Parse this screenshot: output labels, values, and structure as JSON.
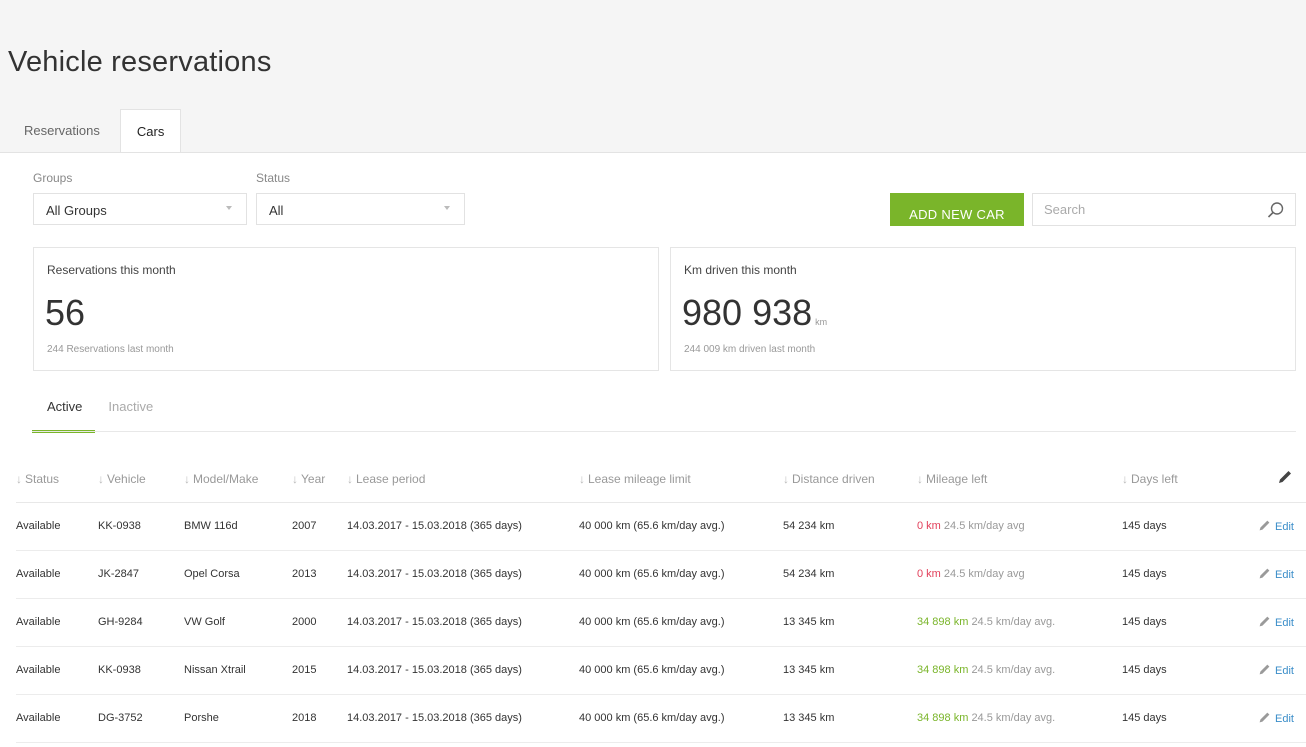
{
  "page": {
    "title": "Vehicle reservations"
  },
  "tabs": [
    {
      "label": "Reservations",
      "active": false
    },
    {
      "label": "Cars",
      "active": true
    }
  ],
  "filters": {
    "groups_label": "Groups",
    "groups_value": "All Groups",
    "status_label": "Status",
    "status_value": "All"
  },
  "actions": {
    "add_label": "ADD NEW CAR",
    "search_placeholder": "Search"
  },
  "stats": {
    "reservations": {
      "label": "Reservations this month",
      "value": "56",
      "sub": "244 Reservations last month"
    },
    "km": {
      "label": "Km driven this month",
      "value": "980 938",
      "unit": "km",
      "sub": "244 009 km driven last month"
    }
  },
  "status_tabs": [
    {
      "label": "Active",
      "active": true
    },
    {
      "label": "Inactive",
      "active": false
    }
  ],
  "table": {
    "columns": [
      "Status",
      "Vehicle",
      "Model/Make",
      "Year",
      "Lease period",
      "Lease mileage limit",
      "Distance driven",
      "Mileage left",
      "Days left"
    ],
    "edit_label": "Edit",
    "rows": [
      {
        "status": "Available",
        "vehicle": "KK-0938",
        "model": "BMW 116d",
        "year": "2007",
        "lease": "14.03.2017 - 15.03.2018 (365 days)",
        "limit": "40 000 km (65.6 km/day avg.)",
        "driven": "54 234 km",
        "driven_state": "over",
        "left": "0 km",
        "left_avg": "24.5 km/day avg",
        "days": "145 days"
      },
      {
        "status": "Available",
        "vehicle": "JK-2847",
        "model": "Opel Corsa",
        "year": "2013",
        "lease": "14.03.2017 - 15.03.2018 (365 days)",
        "limit": "40 000 km (65.6 km/day avg.)",
        "driven": "54 234 km",
        "driven_state": "over",
        "left": "0 km",
        "left_avg": "24.5 km/day avg",
        "days": "145 days"
      },
      {
        "status": "Available",
        "vehicle": "GH-9284",
        "model": "VW Golf",
        "year": "2000",
        "lease": "14.03.2017 - 15.03.2018 (365 days)",
        "limit": "40 000 km (65.6 km/day avg.)",
        "driven": "13 345 km",
        "driven_state": "ok",
        "left": "34 898 km",
        "left_avg": "24.5 km/day avg.",
        "days": "145 days"
      },
      {
        "status": "Available",
        "vehicle": "KK-0938",
        "model": "Nissan Xtrail",
        "year": "2015",
        "lease": "14.03.2017 - 15.03.2018 (365 days)",
        "limit": "40 000 km (65.6 km/day avg.)",
        "driven": "13 345 km",
        "driven_state": "ok",
        "left": "34 898 km",
        "left_avg": "24.5 km/day avg.",
        "days": "145 days"
      },
      {
        "status": "Available",
        "vehicle": "DG-3752",
        "model": "Porshe",
        "year": "2018",
        "lease": "14.03.2017 - 15.03.2018 (365 days)",
        "limit": "40 000 km (65.6 km/day avg.)",
        "driven": "13 345 km",
        "driven_state": "ok",
        "left": "34 898 km",
        "left_avg": "24.5 km/day avg.",
        "days": "145 days"
      }
    ]
  },
  "colors": {
    "accent": "#7ab52a",
    "danger": "#e2405b",
    "link": "#3b8ec9"
  },
  "icons": {
    "search": "search-icon",
    "edit": "pencil-icon",
    "sort": "sort-arrow-icon",
    "caret": "chevron-down-icon"
  }
}
